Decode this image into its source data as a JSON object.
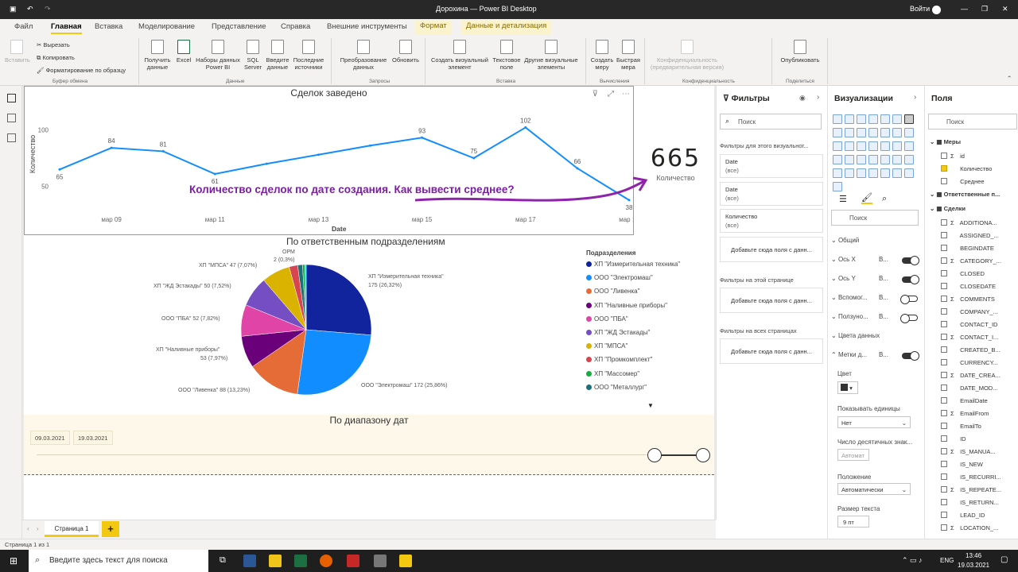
{
  "window": {
    "title": "Дорохина — Power BI Desktop",
    "signin": "Войти"
  },
  "ribbon": {
    "tabs": [
      "Файл",
      "Главная",
      "Вставка",
      "Моделирование",
      "Представление",
      "Справка",
      "Внешние инструменты",
      "Формат",
      "Данные и детализация"
    ],
    "clipboard": {
      "paste": "Вставить",
      "cut": "Вырезать",
      "copy": "Копировать",
      "format_painter": "Форматирование по образцу",
      "group": "Буфер обмена"
    },
    "data": {
      "get_data": "Получить данные",
      "excel": "Excel",
      "pbi_datasets": "Наборы данных Power BI",
      "sql": "SQL Server",
      "enter_data": "Введите данные",
      "recent": "Последние источники",
      "group": "Данные"
    },
    "queries": {
      "transform": "Преобразование данных",
      "refresh": "Обновить",
      "group": "Запросы"
    },
    "insert": {
      "new_visual": "Создать визуальный элемент",
      "textbox": "Текстовое поле",
      "more_visuals": "Другие визуальные элементы",
      "group": "Вставка"
    },
    "calc": {
      "new_measure": "Создать меру",
      "quick_measure": "Быстрая мера",
      "group": "Вычисления"
    },
    "sensitivity": {
      "label": "Конфиденциальность (предварительная версия)",
      "group": "Конфиденциальность"
    },
    "share": {
      "publish": "Опубликовать",
      "group": "Поделиться"
    }
  },
  "line_visual": {
    "title": "Сделок заведено",
    "ylabel": "Количество",
    "xlabel": "Date"
  },
  "chart_data": [
    {
      "type": "line",
      "title": "Сделок заведено",
      "xlabel": "Date",
      "ylabel": "Количество",
      "x": [
        "мар 08",
        "мар 09",
        "мар 10",
        "мар 11",
        "мар 12",
        "мар 13",
        "мар 14",
        "мар 15",
        "мар 16",
        "мар 17",
        "мар 18",
        "мар 19"
      ],
      "y_labels_shown": [
        65,
        84,
        81,
        61,
        null,
        null,
        null,
        93,
        75,
        102,
        66,
        38
      ],
      "y": [
        65,
        84,
        81,
        61,
        70,
        78,
        86,
        93,
        75,
        102,
        66,
        38
      ],
      "xticks": [
        "мар 09",
        "мар 11",
        "мар 13",
        "мар 15",
        "мар 17",
        "мар 19"
      ],
      "yticks": [
        50,
        100
      ],
      "ylim": [
        40,
        110
      ],
      "grid": false
    },
    {
      "type": "pie",
      "title": "По ответственным подразделениям",
      "legend_title": "Подразделения",
      "slices": [
        {
          "label": "ХП \"Измерительная техника\"",
          "value": 175,
          "pct": "26,32%",
          "color": "#12239e"
        },
        {
          "label": "ООО \"Электромаш\"",
          "value": 172,
          "pct": "25,86%",
          "color": "#118dff"
        },
        {
          "label": "ООО \"Ливенка\"",
          "value": 88,
          "pct": "13,23%",
          "color": "#e66c37"
        },
        {
          "label": "ХП \"Наливные приборы\"",
          "value": 53,
          "pct": "7,97%",
          "color": "#6b007b"
        },
        {
          "label": "ООО \"ПБА\"",
          "value": 52,
          "pct": "7,82%",
          "color": "#e044a7"
        },
        {
          "label": "ХП \"ЖД Эстакады\"",
          "value": 50,
          "pct": "7,52%",
          "color": "#744ec2"
        },
        {
          "label": "ХП \"МПСА\"",
          "value": 47,
          "pct": "7,07%",
          "color": "#d9b300"
        },
        {
          "label": "ХП \"Промкомплект\"",
          "value": 14,
          "pct": "2,11%",
          "color": "#d64550"
        },
        {
          "label": "ХП \"Массомер\"",
          "value": 8,
          "pct": "1,20%",
          "color": "#197278"
        },
        {
          "label": "ООО \"Металлург\"",
          "value": 4,
          "pct": "0,60%",
          "color": "#1aab40"
        },
        {
          "label": "ОРМ",
          "value": 2,
          "pct": "0,3%",
          "color": "#15c6f4"
        }
      ]
    }
  ],
  "pie_labels": {
    "izm": "ХП \"Измерительная техника\"",
    "izm2": "175 (26,32%)",
    "elek": "ООО \"Электромаш\" 172 (25,86%)",
    "liv": "ООО \"Ливенка\" 88 (13,23%)",
    "nal": "ХП \"Наливные приборы\"",
    "nal2": "53 (7,97%)",
    "pba": "ООО \"ПБА\" 52 (7,82%)",
    "zhd": "ХП \"ЖД Эстакады\" 50 (7,52%)",
    "mpsa": "ХП \"МПСА\" 47 (7,07%)",
    "orm": "ОРМ",
    "orm2": "2 (0,3%)"
  },
  "legend": {
    "title": "Подразделения",
    "items": [
      {
        "label": "ХП \"Измерительная техника\"",
        "color": "#12239e"
      },
      {
        "label": "ООО \"Электромаш\"",
        "color": "#118dff"
      },
      {
        "label": "ООО \"Ливенка\"",
        "color": "#e66c37"
      },
      {
        "label": "ХП \"Наливные приборы\"",
        "color": "#6b007b"
      },
      {
        "label": "ООО \"ПБА\"",
        "color": "#e044a7"
      },
      {
        "label": "ХП \"ЖД Эстакады\"",
        "color": "#744ec2"
      },
      {
        "label": "ХП \"МПСА\"",
        "color": "#d9b300"
      },
      {
        "label": "ХП \"Промкомплект\"",
        "color": "#d64550"
      },
      {
        "label": "ХП \"Массомер\"",
        "color": "#1aab40"
      },
      {
        "label": "ООО \"Металлург\"",
        "color": "#197278"
      }
    ]
  },
  "card": {
    "value": "665",
    "label": "Количество"
  },
  "annotation": "Количество сделок по дате создания. Как вывести среднее?",
  "slicer": {
    "title": "По диапазону дат",
    "from": "09.03.2021",
    "to": "19.03.2021"
  },
  "filters": {
    "title": "Фильтры",
    "search": "Поиск",
    "visual_section": "Фильтры для этого визуальног...",
    "cards": [
      {
        "name": "Date",
        "state": "(все)"
      },
      {
        "name": "Date",
        "state": "(все)"
      },
      {
        "name": "Количество",
        "state": "(все)"
      }
    ],
    "add": "Добавьте сюда поля с данн...",
    "page_section": "Фильтры на этой странице",
    "all_section": "Фильтры на всех страницах"
  },
  "viz": {
    "title": "Визуализации",
    "search": "Поиск",
    "general": "Общий",
    "xaxis": "Ось X",
    "yaxis": "Ось Y",
    "aux": "Вспомог...",
    "slider": "Ползуно...",
    "datacolors": "Цвета данных",
    "datalabels": "Метки д...",
    "color": "Цвет",
    "units": "Показывать единицы",
    "units_val": "Нет",
    "decimals": "Число десятичных знак...",
    "decimals_val": "Автомат",
    "position": "Положение",
    "position_val": "Автоматически",
    "fontsize": "Размер текста",
    "fontsize_val": "9 пт",
    "b": "В..."
  },
  "fields": {
    "title": "Поля",
    "search": "Поиск",
    "tables": [
      {
        "name": "Меры",
        "items": [
          "id",
          "Количество",
          "Среднее"
        ]
      },
      {
        "name": "Ответственные п...",
        "items": []
      },
      {
        "name": "Сделки",
        "items": [
          "ADDITIONA...",
          "ASSIGNED_...",
          "BEGINDATE",
          "CATEGORY_...",
          "CLOSED",
          "CLOSEDATE",
          "COMMENTS",
          "COMPANY_...",
          "CONTACT_ID",
          "CONTACT_I...",
          "CREATED_B...",
          "CURRENCY...",
          "DATE_CREA...",
          "DATE_MOD...",
          "EmailDate",
          "EmailFrom",
          "EmailTo",
          "ID",
          "IS_MANUA...",
          "IS_NEW",
          "IS_RECURRI...",
          "IS_REPEATE...",
          "IS_RETURN...",
          "LEAD_ID",
          "LOCATION_..."
        ]
      }
    ]
  },
  "pagebar": {
    "tab": "Страница 1",
    "add": "+"
  },
  "status": "Страница 1 из 1",
  "taskbar": {
    "search": "Введите здесь текст для поиска",
    "lang": "ENG",
    "time": "13:46",
    "date": "19.03.2021"
  }
}
